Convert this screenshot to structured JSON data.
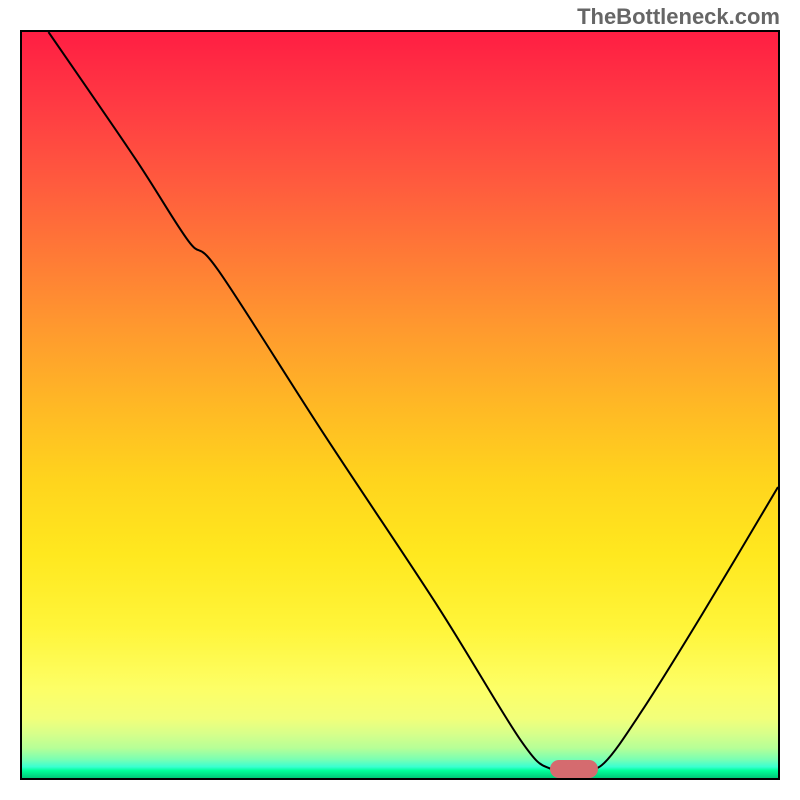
{
  "attribution_text": "TheBottleneck.com",
  "chart_data": {
    "type": "line",
    "title": "",
    "xlabel": "",
    "ylabel": "",
    "xlim": [
      0,
      100
    ],
    "ylim": [
      0,
      100
    ],
    "curve_y_of_x": [
      {
        "x": 3.5,
        "y": 100
      },
      {
        "x": 15,
        "y": 83
      },
      {
        "x": 22,
        "y": 72
      },
      {
        "x": 26,
        "y": 68
      },
      {
        "x": 40,
        "y": 46
      },
      {
        "x": 55,
        "y": 23
      },
      {
        "x": 66,
        "y": 5
      },
      {
        "x": 70,
        "y": 1.2
      },
      {
        "x": 74,
        "y": 1.2
      },
      {
        "x": 77,
        "y": 2
      },
      {
        "x": 82,
        "y": 9
      },
      {
        "x": 90,
        "y": 22
      },
      {
        "x": 100,
        "y": 39
      }
    ],
    "marker": {
      "x": 73,
      "y": 1.2
    },
    "gradient": [
      {
        "stop": 0,
        "color": "#ff1e43"
      },
      {
        "stop": 0.5,
        "color": "#ffd41d"
      },
      {
        "stop": 0.88,
        "color": "#fdff66"
      },
      {
        "stop": 1.0,
        "color": "#00c877"
      }
    ]
  }
}
